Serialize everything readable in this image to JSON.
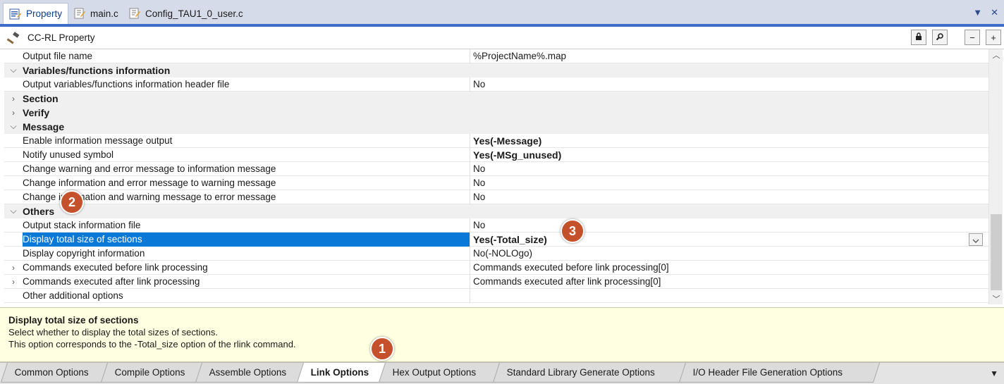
{
  "doc_tabs": [
    {
      "label": "Property",
      "icon": "property-icon",
      "active": true
    },
    {
      "label": "main.c",
      "icon": "c-file-icon",
      "active": false
    },
    {
      "label": "Config_TAU1_0_user.c",
      "icon": "c-file-icon",
      "active": false
    }
  ],
  "panel": {
    "title": "CC-RL Property",
    "icon": "hammer-icon",
    "buttons": [
      {
        "name": "lock-button",
        "glyph": "lock-icon"
      },
      {
        "name": "search-button",
        "glyph": "search-icon"
      },
      {
        "name": "collapse-button",
        "glyph": "minus-icon",
        "label": "−"
      },
      {
        "name": "expand-button",
        "glyph": "plus-icon",
        "label": "+"
      }
    ]
  },
  "rows": [
    {
      "type": "prop",
      "name": "Output file name",
      "value": "%ProjectName%.map"
    },
    {
      "type": "cat",
      "state": "expanded",
      "name": "Variables/functions information"
    },
    {
      "type": "prop",
      "name": "Output variables/functions information header file",
      "value": "No"
    },
    {
      "type": "cat",
      "state": "collapsed",
      "name": "Section"
    },
    {
      "type": "cat",
      "state": "collapsed",
      "name": "Verify"
    },
    {
      "type": "cat",
      "state": "expanded",
      "name": "Message"
    },
    {
      "type": "prop",
      "name": "Enable information message output",
      "value": "Yes(-Message)",
      "bold": true
    },
    {
      "type": "prop",
      "name": "Notify unused symbol",
      "value": "Yes(-MSg_unused)",
      "bold": true
    },
    {
      "type": "prop",
      "name": "Change warning and error message to information message",
      "value": "No"
    },
    {
      "type": "prop",
      "name": "Change information and error message to warning message",
      "value": "No"
    },
    {
      "type": "prop",
      "name": "Change information and warning message to error message",
      "value": "No"
    },
    {
      "type": "cat",
      "state": "expanded",
      "name": "Others"
    },
    {
      "type": "prop",
      "name": "Output stack information file",
      "value": "No"
    },
    {
      "type": "prop",
      "name": "Display total size of sections",
      "value": "Yes(-Total_size)",
      "bold": true,
      "selected": true
    },
    {
      "type": "prop",
      "name": "Display copyright information",
      "value": "No(-NOLOgo)"
    },
    {
      "type": "prop",
      "state": "collapsed",
      "name": "Commands executed before link processing",
      "value": "Commands executed before link processing[0]"
    },
    {
      "type": "prop",
      "state": "collapsed",
      "name": "Commands executed after link processing",
      "value": "Commands executed after link processing[0]"
    },
    {
      "type": "prop",
      "name": "Other additional options",
      "value": ""
    }
  ],
  "description": {
    "title": "Display total size of sections",
    "line1": "Select whether to display the total sizes of sections.",
    "line2": "This option corresponds to the -Total_size option of the rlink command."
  },
  "bottom_tabs": [
    {
      "label": "Common Options",
      "active": false
    },
    {
      "label": "Compile Options",
      "active": false
    },
    {
      "label": "Assemble Options",
      "active": false
    },
    {
      "label": "Link Options",
      "active": true
    },
    {
      "label": "Hex Output Options",
      "active": false
    },
    {
      "label": "Standard Library Generate Options",
      "active": false
    },
    {
      "label": "I/O Header File Generation Options",
      "active": false
    }
  ],
  "callouts": [
    "1",
    "2",
    "3"
  ],
  "colors": {
    "accent": "#3e6cc9",
    "selection": "#0a78d7",
    "description_bg": "#ffffe1",
    "callout": "#c4512b"
  }
}
